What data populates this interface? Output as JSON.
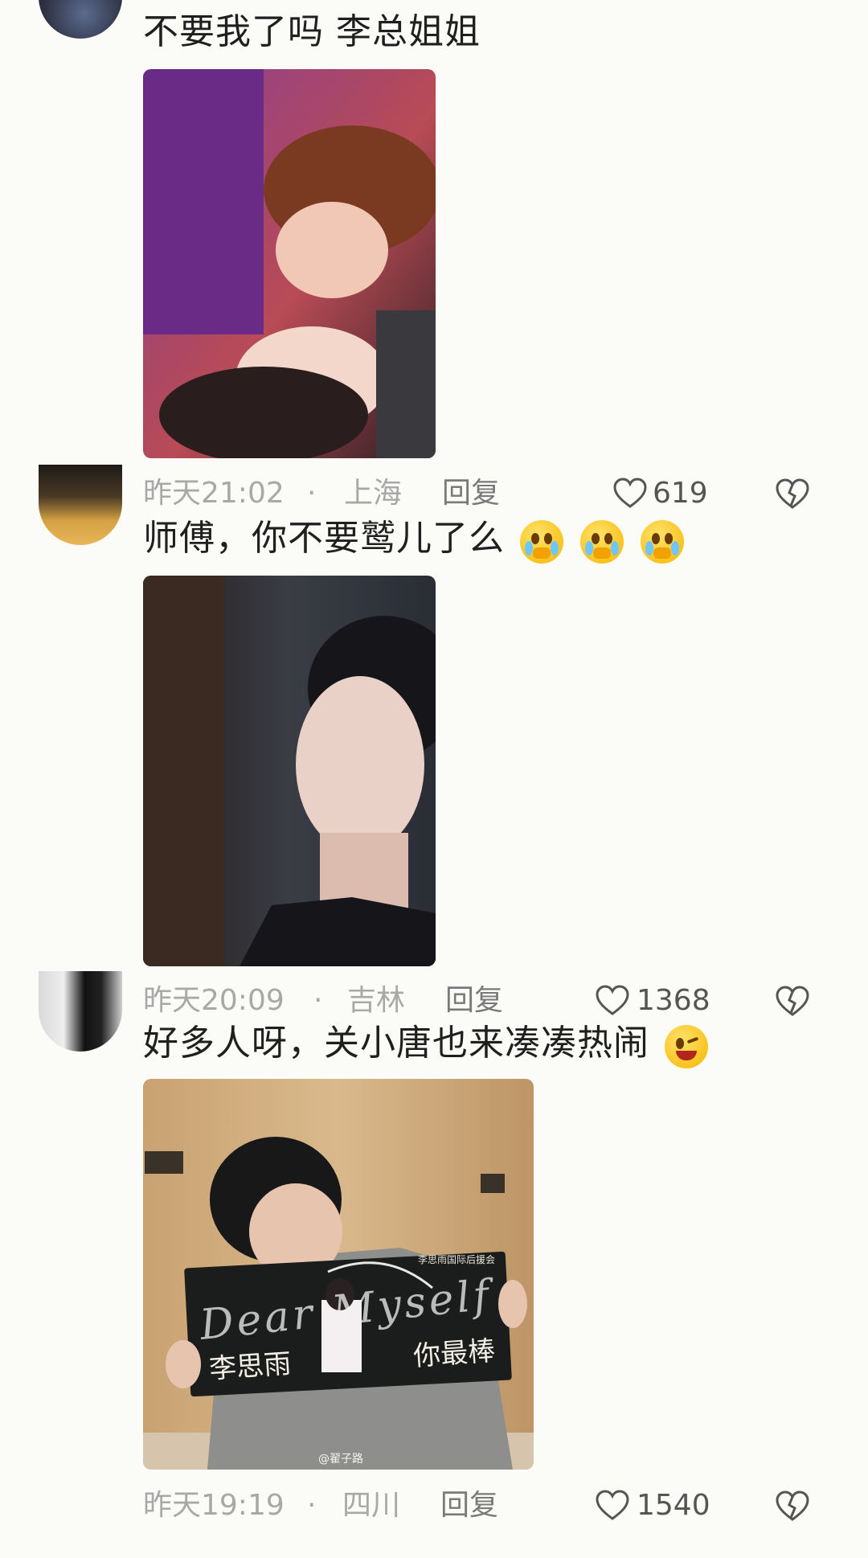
{
  "comments": [
    {
      "text": "不要我了吗  李总姐姐",
      "time": "昨天21:02",
      "location": "上海",
      "reply_label": "回复",
      "likes": "619",
      "photo_icon": "photo-kiss-scene"
    },
    {
      "text": "师傅，你不要鹫儿了么",
      "emoji": [
        "crying-face-emoji",
        "crying-face-emoji",
        "crying-face-emoji"
      ],
      "time": "昨天20:09",
      "location": "吉林",
      "reply_label": "回复",
      "likes": "1368",
      "photo_icon": "photo-man-looking-up"
    },
    {
      "text": "好多人呀，关小唐也来凑凑热闹",
      "emoji": [
        "winking-tongue-emoji"
      ],
      "time": "昨天19:19",
      "location": "四川",
      "reply_label": "回复",
      "likes": "1540",
      "photo_icon": "photo-fan-holding-banner"
    }
  ],
  "banner": {
    "top_text": "李思雨国际后援会",
    "script_text": "Dear Myself",
    "left_text": "李思雨",
    "right_text": "你最棒"
  },
  "watermark": "@翟子路",
  "separator": "·",
  "colors": {
    "meta_gray": "#a8a8a8",
    "background": "#fbfbf8",
    "text": "#1f1f1f"
  }
}
